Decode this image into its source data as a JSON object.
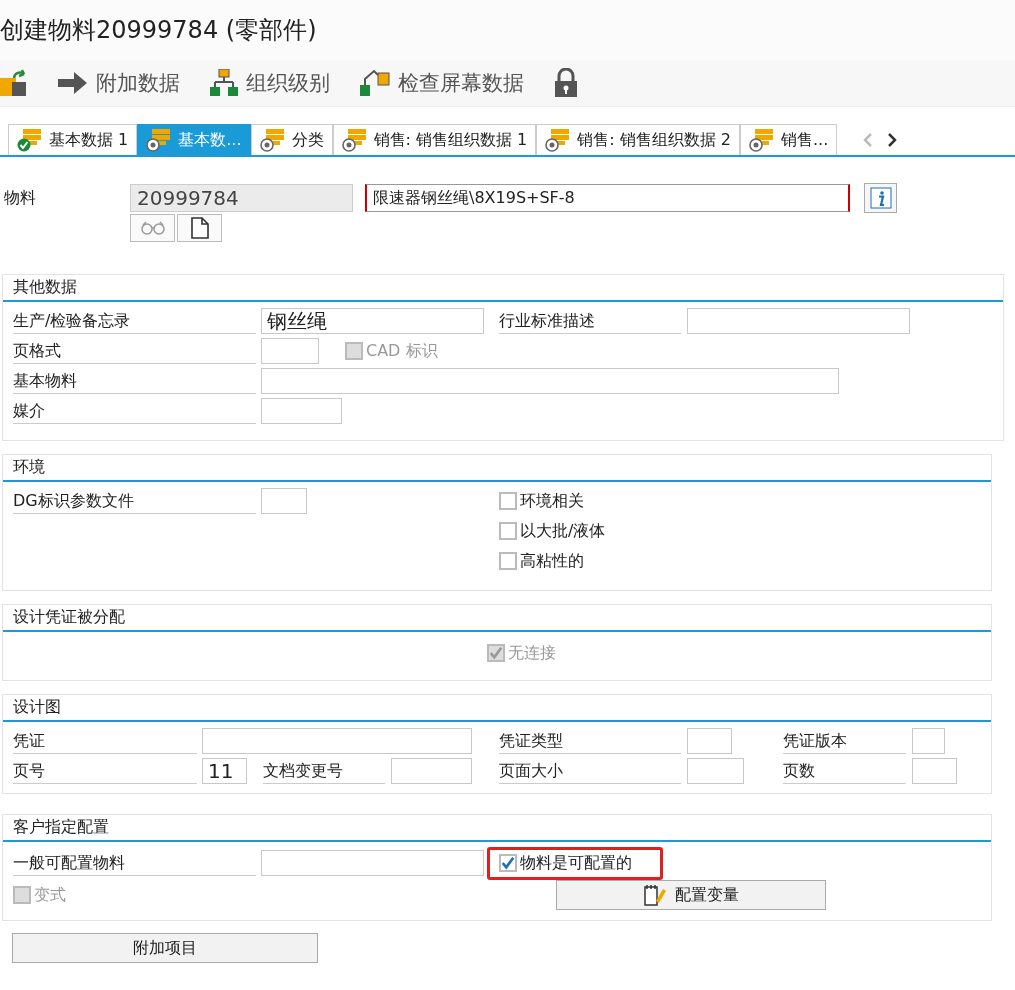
{
  "title": "创建物料20999784 (零部件)",
  "toolbar": [
    {
      "kind": "icon"
    },
    {
      "kind": "labeled",
      "label": "附加数据"
    },
    {
      "kind": "labeled",
      "label": "组织级别"
    },
    {
      "kind": "labeled",
      "label": "检查屏幕数据"
    },
    {
      "kind": "icon"
    }
  ],
  "tabs": [
    {
      "label": "基本数据 1",
      "selected": false,
      "complete": true
    },
    {
      "label": "基本数...",
      "selected": true,
      "complete": false
    },
    {
      "label": "分类",
      "selected": false,
      "complete": false
    },
    {
      "label": "销售: 销售组织数据 1",
      "selected": false,
      "complete": false
    },
    {
      "label": "销售: 销售组织数据 2",
      "selected": false,
      "complete": false
    },
    {
      "label": "销售...",
      "selected": false,
      "complete": false
    }
  ],
  "material": {
    "label": "物料",
    "number": "20999784",
    "description": "限速器钢丝绳\\8X19S+SF-8",
    "required": true
  },
  "other_data": {
    "title": "其他数据",
    "fields": [
      {
        "label": "生产/检验备忘录",
        "value": "钢丝绳"
      },
      {
        "label": "行业标准描述"
      },
      {
        "label": "页格式"
      },
      {
        "label": "基本物料"
      },
      {
        "label": "媒介"
      }
    ],
    "cad": {
      "label": "CAD 标识",
      "checked": false,
      "disabled": true
    }
  },
  "environment": {
    "title": "环境",
    "field": {
      "label": "DG标识参数文件"
    },
    "checks": [
      {
        "label": "环境相关",
        "checked": false,
        "disabled": false
      },
      {
        "label": "以大批/液体",
        "checked": false,
        "disabled": false
      },
      {
        "label": "高粘性的",
        "checked": false,
        "disabled": false
      }
    ]
  },
  "design_doc": {
    "title": "设计凭证被分配",
    "check": {
      "label": "无连接",
      "checked": true,
      "disabled": true
    }
  },
  "drawing": {
    "title": "设计图",
    "fields": [
      {
        "label": "凭证"
      },
      {
        "label": "凭证类型"
      },
      {
        "label": "凭证版本"
      },
      {
        "label": "页号",
        "value": "11"
      },
      {
        "label": "文档变更号"
      },
      {
        "label": "页面大小"
      },
      {
        "label": "页数"
      }
    ]
  },
  "config": {
    "title": "客户指定配置",
    "field": {
      "label": "一般可配置物料"
    },
    "configurable": {
      "label": "物料是可配置的",
      "checked": true,
      "disabled": false,
      "highlighted": true
    },
    "variant": {
      "label": "变式",
      "checked": false,
      "disabled": true
    },
    "button": "配置变量"
  },
  "extra_button": "附加项目"
}
